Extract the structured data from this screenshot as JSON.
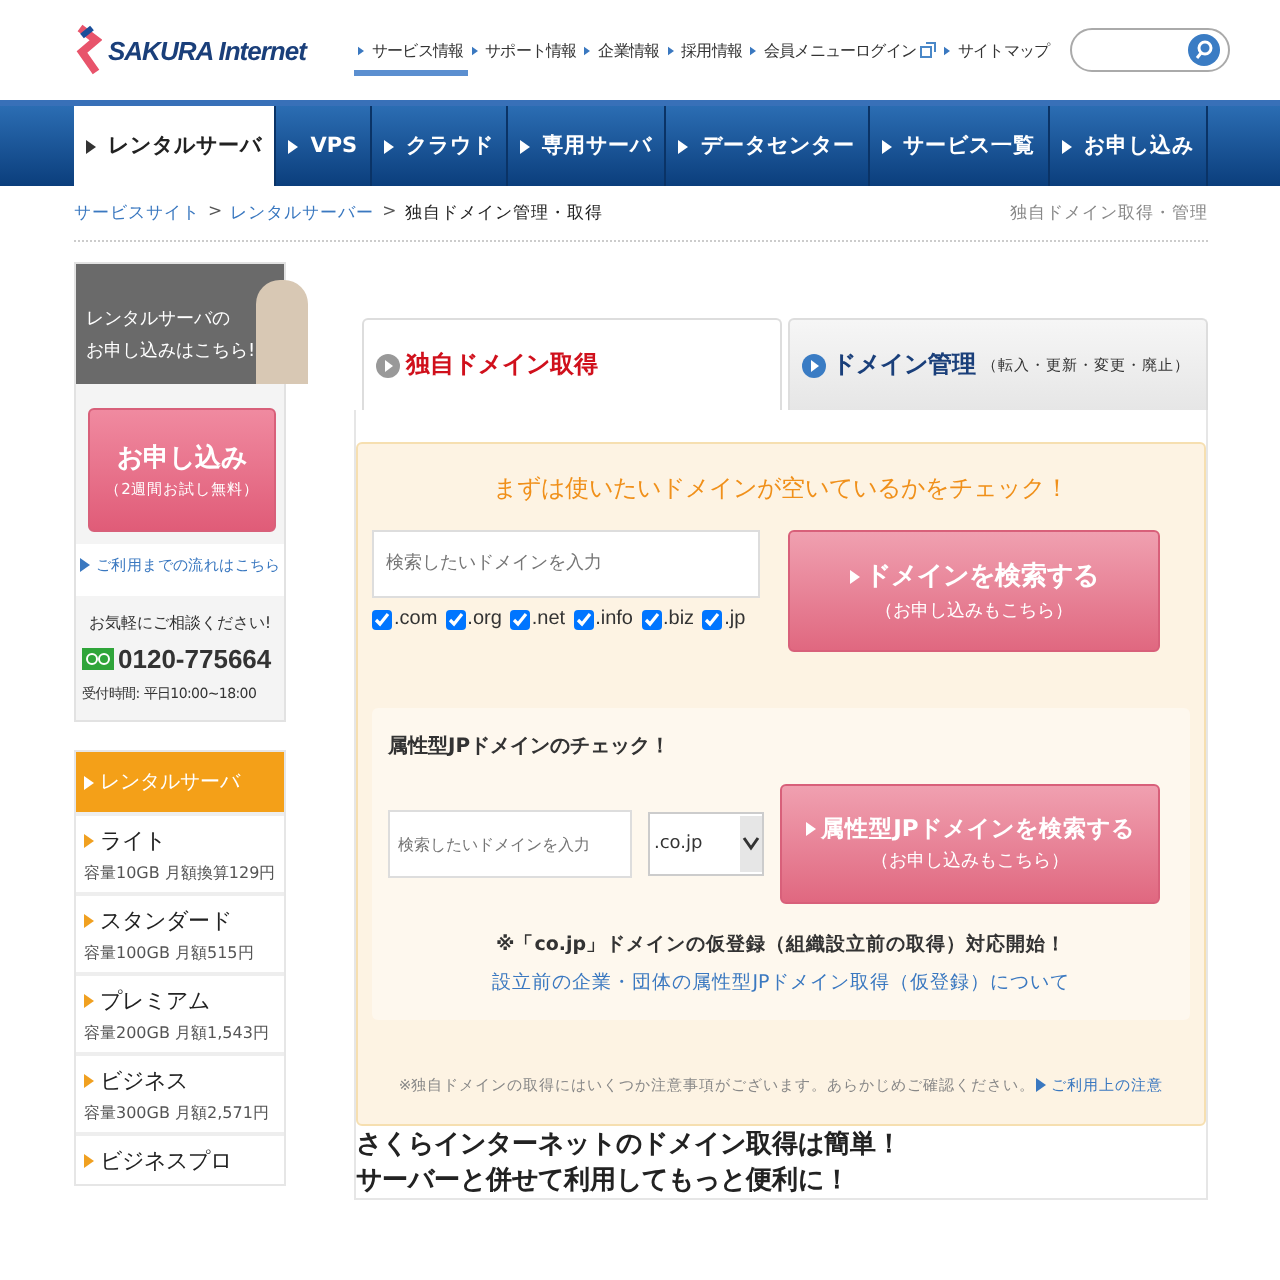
{
  "header": {
    "logo_text": "SAKURA Internet",
    "links": [
      {
        "label": "サービス情報",
        "selected": true,
        "external": false
      },
      {
        "label": "サポート情報",
        "selected": false,
        "external": false
      },
      {
        "label": "企業情報",
        "selected": false,
        "external": false
      },
      {
        "label": "採用情報",
        "selected": false,
        "external": false
      },
      {
        "label": "会員メニューログイン",
        "selected": false,
        "external": true
      },
      {
        "label": "サイトマップ",
        "selected": false,
        "external": false
      }
    ]
  },
  "nav": [
    {
      "label": "レンタルサーバ",
      "selected": true
    },
    {
      "label": "VPS",
      "selected": false
    },
    {
      "label": "クラウド",
      "selected": false
    },
    {
      "label": "専用サーバ",
      "selected": false
    },
    {
      "label": "データセンター",
      "selected": false
    },
    {
      "label": "サービス一覧",
      "selected": false
    },
    {
      "label": "お申し込み",
      "selected": false
    }
  ],
  "breadcrumb": {
    "separator": ">",
    "items": [
      "サービスサイト",
      "レンタルサーバー",
      "独自ドメイン管理・取得"
    ],
    "page_label": "独自ドメイン取得・管理"
  },
  "sidebar": {
    "promo": {
      "lines": [
        "レンタルサーバの",
        "お申し込みはこちら!"
      ],
      "button": {
        "label": "お申し込み",
        "sub": "（2週間お試し無料）"
      },
      "link": "ご利用までの流れはこちら"
    },
    "contact": {
      "heading": "お気軽にご相談ください!",
      "phone": "0120-775664",
      "hours": "受付時間: 平日10:00~18:00"
    },
    "menu": {
      "title": "レンタルサーバ",
      "items": [
        {
          "name": "ライト",
          "detail": "容量10GB 月額換算129円"
        },
        {
          "name": "スタンダード",
          "detail": "容量100GB 月額515円"
        },
        {
          "name": "プレミアム",
          "detail": "容量200GB 月額1,543円"
        },
        {
          "name": "ビジネス",
          "detail": "容量300GB 月額2,571円"
        },
        {
          "name": "ビジネスプロ"
        }
      ]
    }
  },
  "tabs": [
    {
      "label": "独自ドメイン取得",
      "selected": true
    },
    {
      "label": "ドメイン管理",
      "note": "（転入・更新・変更・廃止）",
      "selected": false
    }
  ],
  "check": {
    "title": "まずは使いたいドメインが空いているかをチェック！",
    "placeholder": "検索したいドメインを入力",
    "tlds": [
      {
        "label": ".com",
        "checked": true
      },
      {
        "label": ".org",
        "checked": true
      },
      {
        "label": ".net",
        "checked": true
      },
      {
        "label": ".info",
        "checked": true
      },
      {
        "label": ".biz",
        "checked": true
      },
      {
        "label": ".jp",
        "checked": true
      }
    ],
    "button": {
      "label": "ドメインを検索する",
      "sub": "（お申し込みもこちら）"
    },
    "jp": {
      "title": "属性型JPドメインのチェック！",
      "placeholder": "検索したいドメインを入力",
      "select": ".co.jp",
      "button": {
        "label": "属性型JPドメインを検索する",
        "sub": "（お申し込みもこちら）"
      },
      "notice": "※「co.jp」ドメインの仮登録（組織設立前の取得）対応開始！",
      "link": "設立前の企業・団体の属性型JPドメイン取得（仮登録）について"
    },
    "footnote": "※独自ドメインの取得にはいくつか注意事項がございます。あらかじめご確認ください。",
    "footnote_link": "ご利用上の注意"
  },
  "intro": [
    "さくらインターネットのドメイン取得は簡単！",
    "サーバーと併せて利用してもっと便利に！"
  ]
}
